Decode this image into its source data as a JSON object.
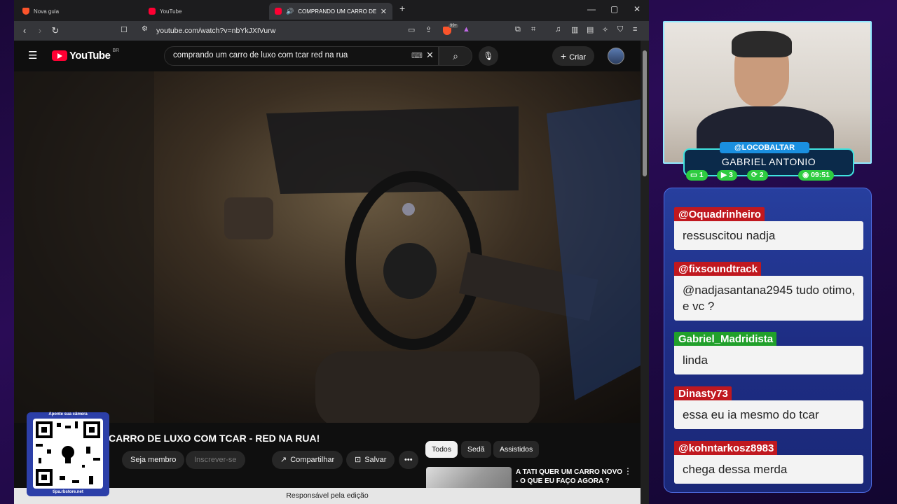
{
  "browser": {
    "tabs": [
      {
        "label": "Nova guia",
        "icon": "brave-icon"
      },
      {
        "label": "YouTube",
        "icon": "youtube-icon"
      },
      {
        "label": "COMPRANDO UM CARRO DE LUXO",
        "icon": "youtube-icon",
        "active": true
      }
    ],
    "url": "youtube.com/watch?v=nbYkJXIVurw",
    "badge_count": "99+",
    "status": "Responsável pela edição"
  },
  "youtube": {
    "region": "BR",
    "search_value": "comprando um carro de luxo com tcar red na rua",
    "create_label": "Criar",
    "video_title": "CARRO DE LUXO COM TCAR - RED NA RUA!",
    "join_label": "Seja membro",
    "subscribe_label": "Inscrever-se",
    "share_label": "Compartilhar",
    "save_label": "Salvar",
    "chips": [
      "Todos",
      "Sedã",
      "Assistidos"
    ],
    "recommended": {
      "title": "A TATI QUER UM CARRO NOVO - O QUE EU FAÇO AGORA ?"
    }
  },
  "qr": {
    "top_text": "Aponte sua câmera",
    "bottom_text": "tipa.rbstore.net"
  },
  "stream": {
    "handle": "@LOCOBALTAR",
    "name": "GABRIEL ANTONIO",
    "stats": [
      {
        "icon": "chat-icon",
        "value": "1",
        "color": "#2ecc40"
      },
      {
        "icon": "video-icon",
        "value": "3",
        "color": "#2ecc40"
      },
      {
        "icon": "sync-icon",
        "value": "2",
        "color": "#2ecc40"
      },
      {
        "icon": "whatsapp-icon",
        "value": "09:51",
        "color": "#2ecc40"
      }
    ]
  },
  "chat": [
    {
      "user": "@Oquadrinheiro",
      "color": "red",
      "text": "ressuscitou nadja"
    },
    {
      "user": "@fixsoundtrack",
      "color": "red",
      "text": "@nadjasantana2945 tudo otimo, e vc ?"
    },
    {
      "user": "Gabriel_Madridista",
      "color": "green",
      "text": "linda"
    },
    {
      "user": "Dinasty73",
      "color": "red",
      "text": "essa eu ia mesmo do tcar"
    },
    {
      "user": "@kohntarkosz8983",
      "color": "red",
      "text": "chega dessa merda"
    }
  ]
}
